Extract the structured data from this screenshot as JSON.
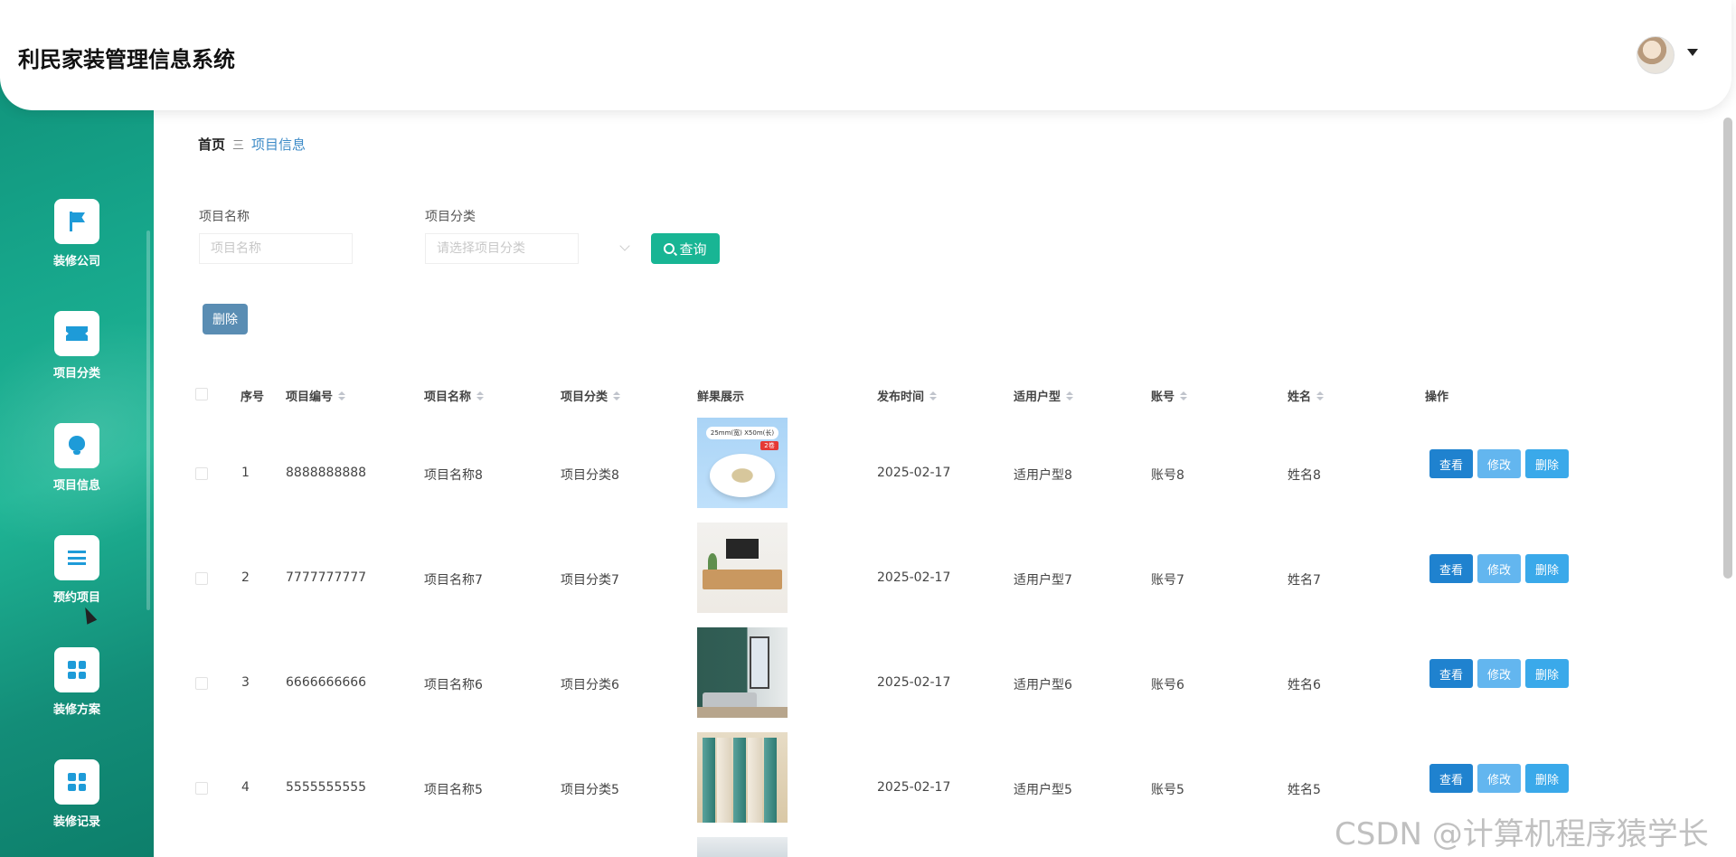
{
  "app": {
    "title": "利民家装管理信息系统"
  },
  "sidebar": {
    "items": [
      {
        "label": "装修公司",
        "icon": "flag-icon"
      },
      {
        "label": "项目分类",
        "icon": "ticket-icon"
      },
      {
        "label": "项目信息",
        "icon": "bulb-icon"
      },
      {
        "label": "预约项目",
        "icon": "list-icon"
      },
      {
        "label": "装修方案",
        "icon": "grid-icon"
      },
      {
        "label": "装修记录",
        "icon": "grid-icon"
      }
    ]
  },
  "breadcrumb": {
    "home": "首页",
    "separator": "三",
    "current": "项目信息"
  },
  "search": {
    "name_label": "项目名称",
    "name_placeholder": "项目名称",
    "category_label": "项目分类",
    "category_placeholder": "请选择项目分类",
    "query_label": "查询"
  },
  "toolbar": {
    "delete_label": "删除"
  },
  "table": {
    "columns": {
      "index": "序号",
      "code": "项目编号",
      "name": "项目名称",
      "category": "项目分类",
      "image": "鲜果展示",
      "date": "发布时间",
      "house_type": "适用户型",
      "account": "账号",
      "person": "姓名",
      "actions": "操作"
    },
    "rows": [
      {
        "index": "1",
        "code": "8888888888",
        "name": "项目名称8",
        "category": "项目分类8",
        "date": "2025-02-17",
        "house_type": "适用户型8",
        "account": "账号8",
        "person": "姓名8"
      },
      {
        "index": "2",
        "code": "7777777777",
        "name": "项目名称7",
        "category": "项目分类7",
        "date": "2025-02-17",
        "house_type": "适用户型7",
        "account": "账号7",
        "person": "姓名7"
      },
      {
        "index": "3",
        "code": "6666666666",
        "name": "项目名称6",
        "category": "项目分类6",
        "date": "2025-02-17",
        "house_type": "适用户型6",
        "account": "账号6",
        "person": "姓名6"
      },
      {
        "index": "4",
        "code": "5555555555",
        "name": "项目名称5",
        "category": "项目分类5",
        "date": "2025-02-17",
        "house_type": "适用户型5",
        "account": "账号5",
        "person": "姓名5"
      }
    ],
    "actions": {
      "view": "查看",
      "edit": "修改",
      "delete": "删除"
    }
  },
  "thumb1": {
    "tag": "25mm(宽) X50m(长)",
    "badge": "2卷"
  },
  "watermark": "CSDN @计算机程序猿学长",
  "colors": {
    "accent": "#18b594",
    "sidebar": "#16a58a",
    "link": "#3d8bc7"
  }
}
